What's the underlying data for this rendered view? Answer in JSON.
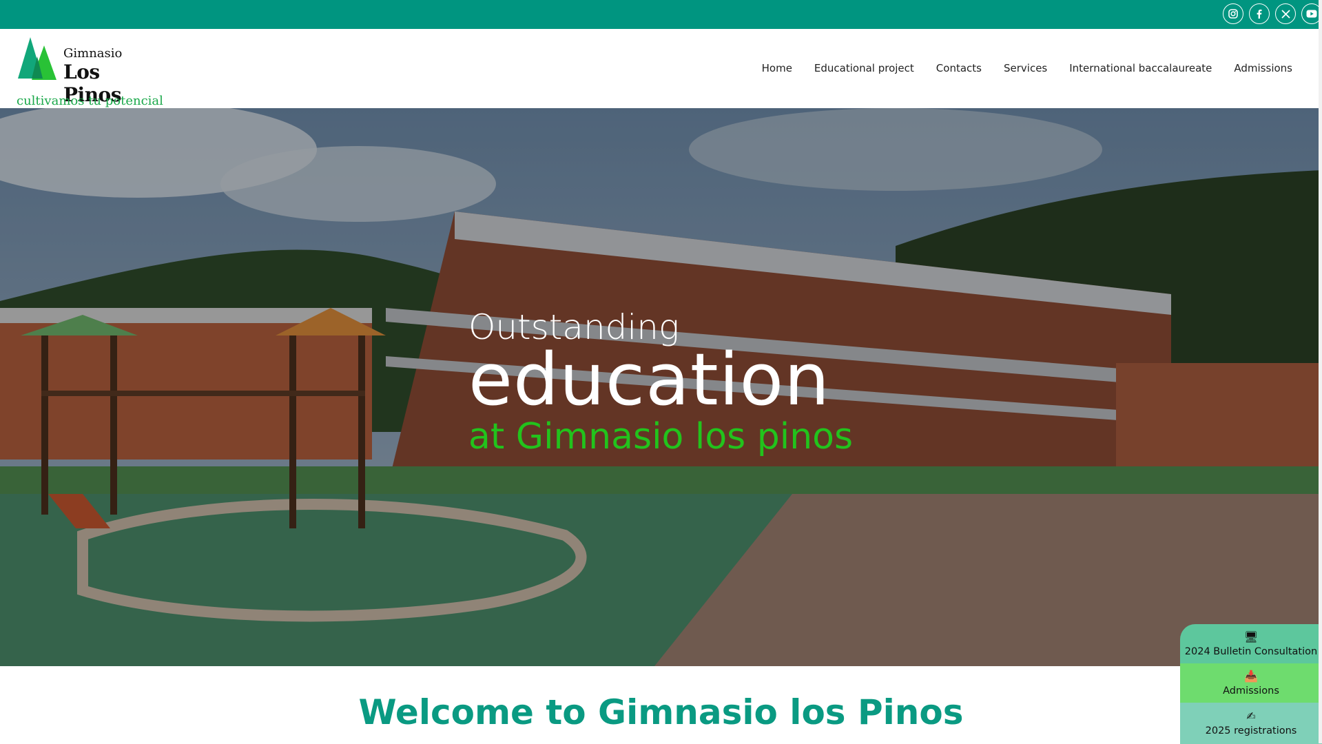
{
  "colors": {
    "topbar": "#009580",
    "accent_green": "#22c31c",
    "welcome_teal": "#0a9a82",
    "tagline_green": "#1aa84a"
  },
  "social": [
    {
      "icon": "instagram-icon"
    },
    {
      "icon": "facebook-icon"
    },
    {
      "icon": "x-twitter-icon"
    },
    {
      "icon": "youtube-icon"
    }
  ],
  "logo": {
    "word1": "Gimnasio",
    "word2": "Los Pinos",
    "tagline": "cultivamos tu potencial"
  },
  "nav": [
    "Home",
    "Educational project",
    "Contacts",
    "Services",
    "International baccalaureate",
    "Admissions"
  ],
  "hero": {
    "line1": "Outstanding",
    "line2": "education",
    "line3": "at Gimnasio los pinos"
  },
  "welcome": "Welcome to Gimnasio los Pinos",
  "quick_links": [
    {
      "icon": "computer-icon",
      "label": "2024 Bulletin Consultation"
    },
    {
      "icon": "inbox-icon",
      "label": "Admissions"
    },
    {
      "icon": "signature-icon",
      "label": "2025 registrations"
    }
  ]
}
